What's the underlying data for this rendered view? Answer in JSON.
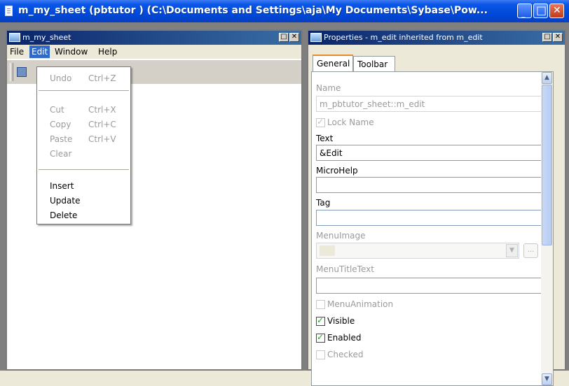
{
  "window": {
    "title": "m_my_sheet (pbtutor ) (C:\\Documents and Settings\\aja\\My Documents\\Sybase\\Pow...",
    "min_glyph": "_",
    "max_glyph": "□",
    "close_glyph": "✕"
  },
  "left_child": {
    "title": "m_my_sheet",
    "max_glyph": "□",
    "close_glyph": "✕",
    "menubar": [
      "File",
      "Edit",
      "Window",
      "Help"
    ],
    "edit_menu": {
      "group1": [
        {
          "label": "Undo",
          "shortcut": "Ctrl+Z"
        }
      ],
      "group2": [
        {
          "label": "Cut",
          "shortcut": "Ctrl+X"
        },
        {
          "label": "Copy",
          "shortcut": "Ctrl+C"
        },
        {
          "label": "Paste",
          "shortcut": "Ctrl+V"
        },
        {
          "label": "Clear",
          "shortcut": ""
        }
      ],
      "group3": [
        {
          "label": "Insert"
        },
        {
          "label": "Update"
        },
        {
          "label": "Delete"
        }
      ]
    }
  },
  "right_child": {
    "title": "Properties - m_edit inherited from m_edit",
    "max_glyph": "□",
    "close_glyph": "✕",
    "tabs": [
      "General",
      "Toolbar"
    ],
    "props": {
      "name_label": "Name",
      "name_value": "m_pbtutor_sheet::m_edit",
      "lock_name_label": "Lock Name",
      "text_label": "Text",
      "text_value": "&Edit",
      "microhelp_label": "MicroHelp",
      "microhelp_value": "",
      "tag_label": "Tag",
      "tag_value": "",
      "menuimage_label": "MenuImage",
      "ellipsis": "...",
      "menutitletext_label": "MenuTitleText",
      "menutitletext_value": "",
      "menuanimation_label": "MenuAnimation",
      "visible_label": "Visible",
      "enabled_label": "Enabled",
      "checked_label": "Checked"
    },
    "checks": {
      "lock_name": true,
      "menuanimation": false,
      "visible": true,
      "enabled": true,
      "checked": false
    }
  },
  "icons": [
    "app-document-icon",
    "minimize-icon",
    "maximize-icon",
    "close-icon",
    "scroll-up-arrow-icon",
    "scroll-down-arrow-icon",
    "dropdown-arrow-icon",
    "checkmark-icon"
  ],
  "colors": {
    "titlebar": "#0047d6",
    "child_titlebar": "#0a246a",
    "menu_highlight": "#316ac5",
    "checkmark": "#21a121",
    "mdi_background": "#808080"
  }
}
